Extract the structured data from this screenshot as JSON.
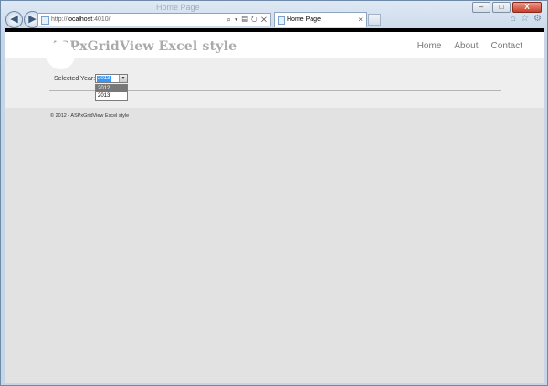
{
  "browser": {
    "titlebar_ghost_text": "Home Page",
    "address": {
      "scheme": "http://",
      "host": "localhost",
      "port_path": ":4010/"
    },
    "tab": {
      "title": "Home Page",
      "close": "×"
    },
    "controls": {
      "minimize": "–",
      "maximize": "□",
      "close": "X"
    },
    "nav": {
      "back": "◀",
      "forward": "▶"
    },
    "address_icons": "⌕ ▾ ▤ ↻ ✕",
    "cmd_icons": [
      "⌂",
      "☆",
      "⚙"
    ]
  },
  "site": {
    "title": "ASPxGridView Excel style",
    "nav": [
      "Home",
      "About",
      "Contact"
    ]
  },
  "main": {
    "year_label": "Selected Year:",
    "year_selected": "2013",
    "year_options": [
      "2012",
      "2013"
    ],
    "dropdown_arrow": "▼"
  },
  "footer": {
    "text": "© 2012 - ASPxGridView Excel style"
  },
  "colors": {
    "accent": "#3399ff",
    "header_bg": "#ffffff",
    "page_bg": "#e2e2e2",
    "main_bg": "#eeeeee"
  }
}
